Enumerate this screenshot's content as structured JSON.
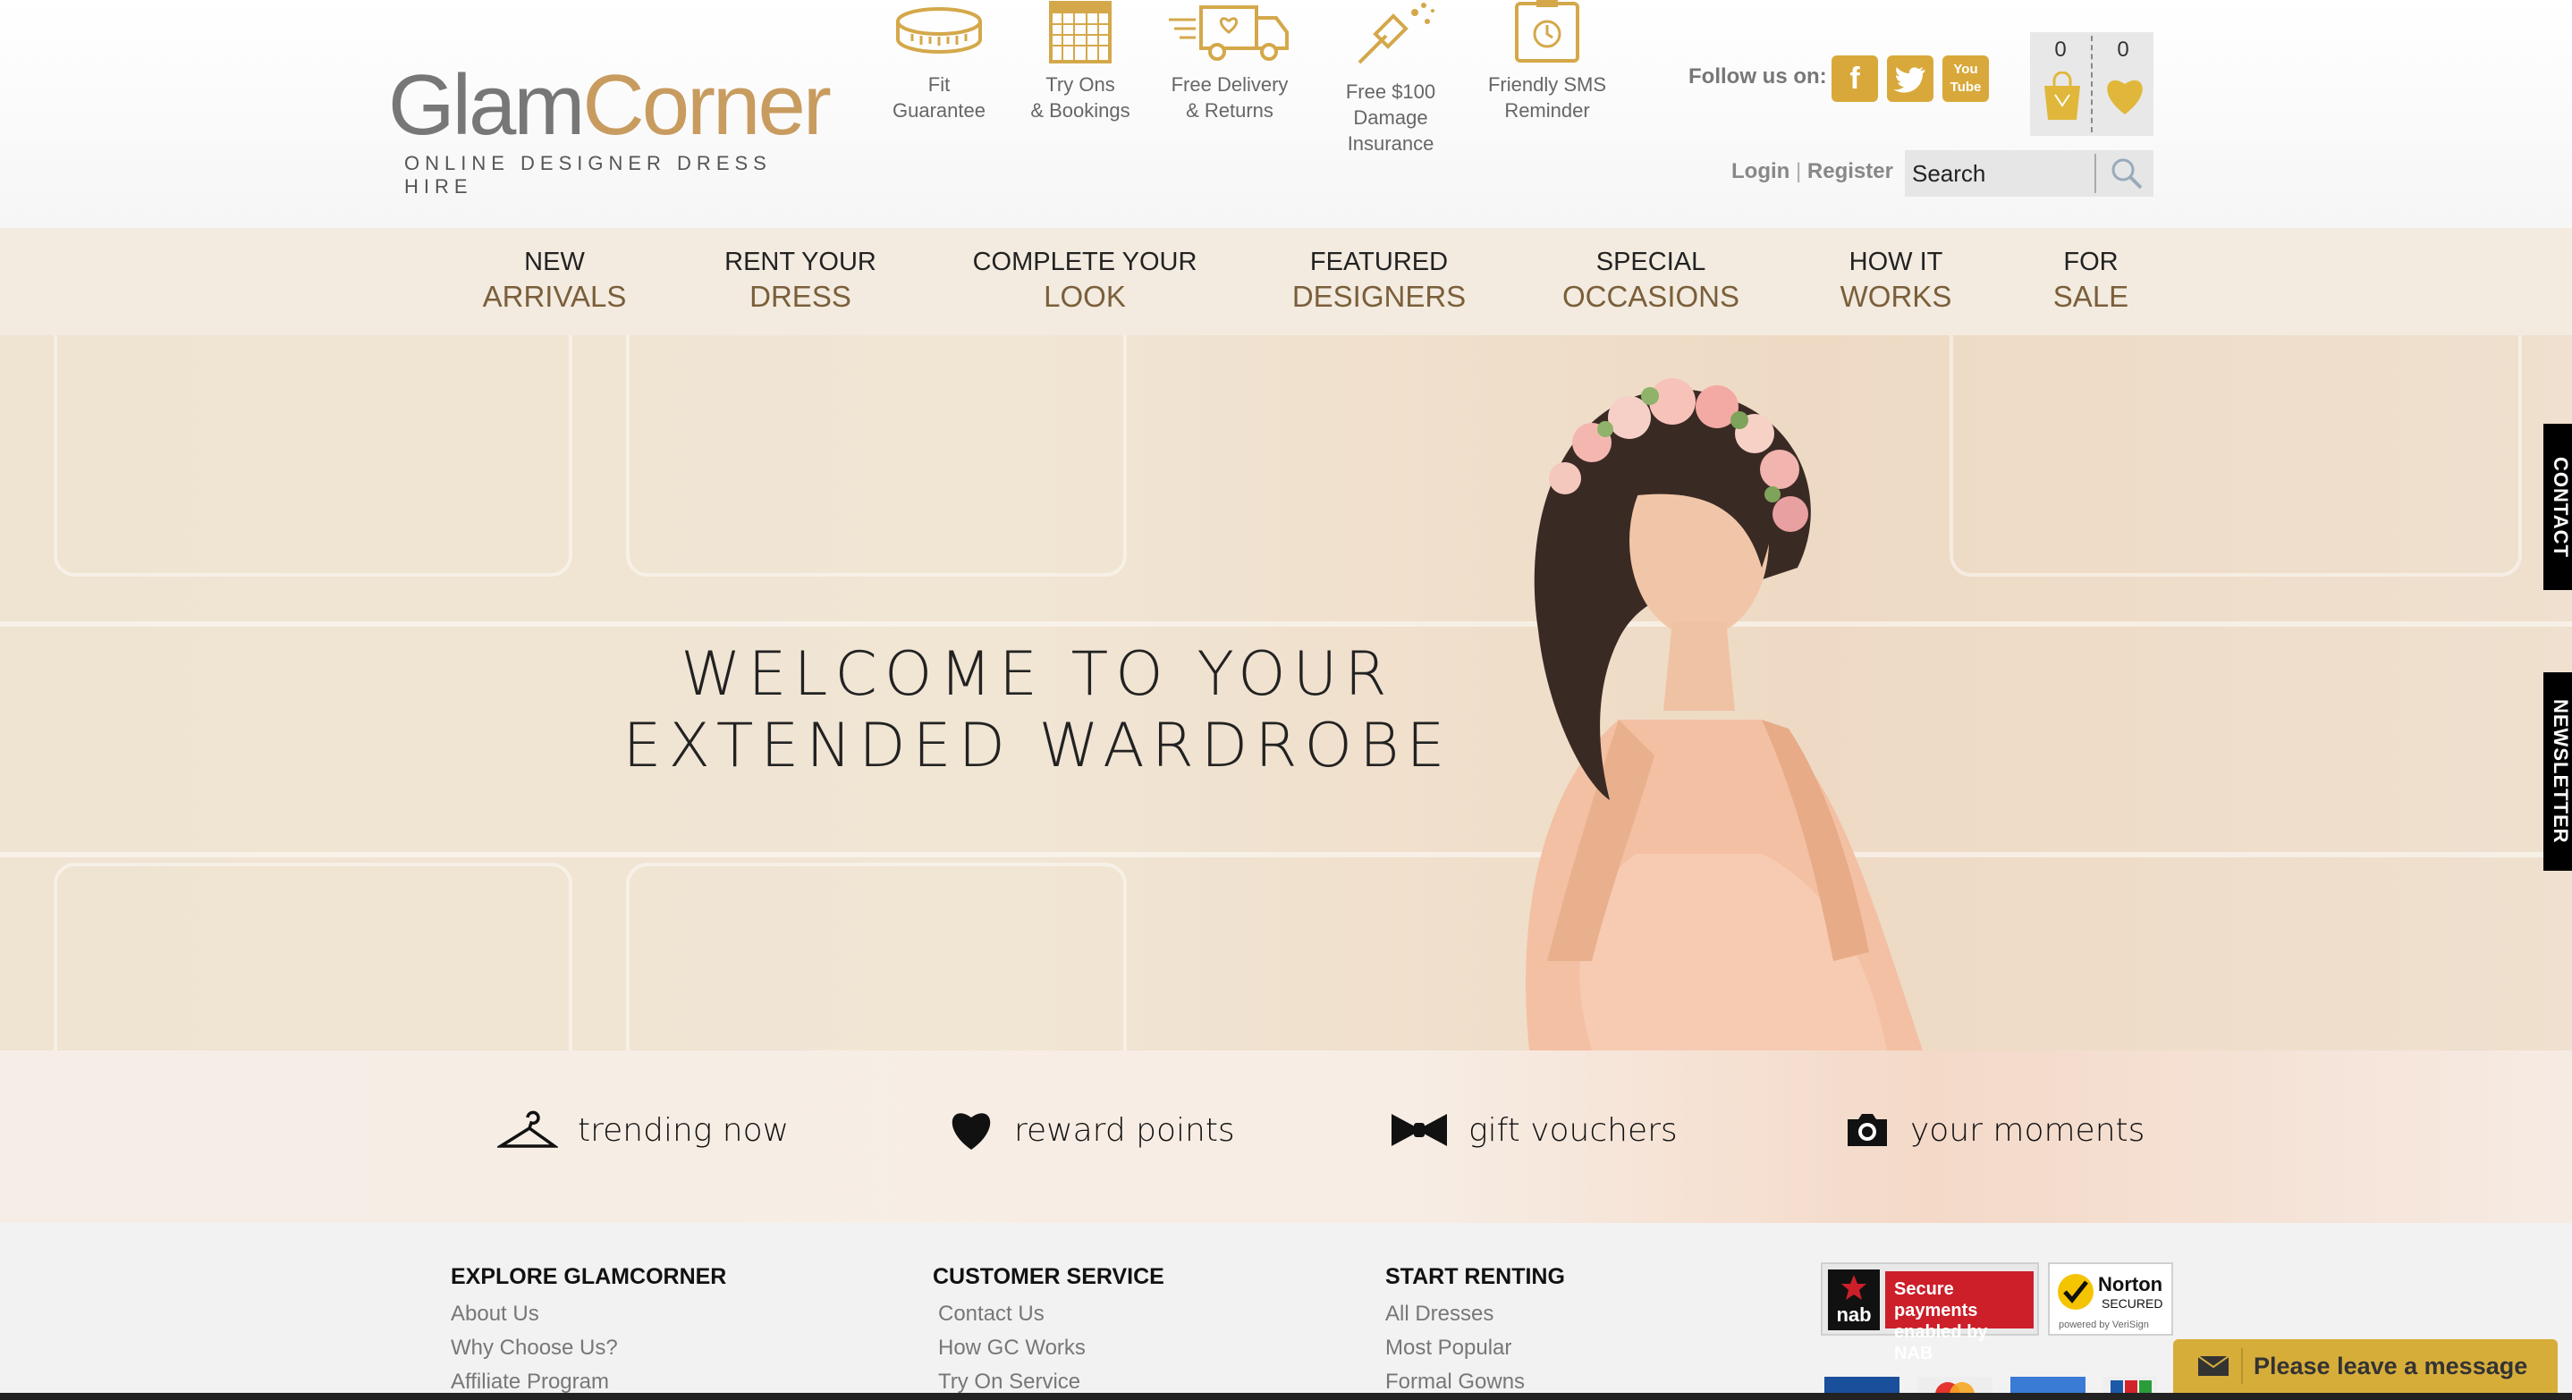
{
  "logo": {
    "glam": "Glam",
    "corner": "Corner",
    "tagline": "ONLINE DESIGNER DRESS HIRE"
  },
  "features": [
    {
      "icon": "tape-measure-icon",
      "line1": "Fit",
      "line2": "Guarantee"
    },
    {
      "icon": "calendar-icon",
      "line1": "Try Ons",
      "line2": "& Bookings"
    },
    {
      "icon": "delivery-truck-icon",
      "line1": "Free Delivery",
      "line2": "& Returns"
    },
    {
      "icon": "insurance-pin-icon",
      "line1": "Free $100",
      "line2": "Damage Insurance"
    },
    {
      "icon": "sms-phone-icon",
      "line1": "Friendly SMS",
      "line2": "Reminder"
    }
  ],
  "social": {
    "label": "Follow us on:",
    "facebook": "f",
    "youtube_1": "You",
    "youtube_2": "Tube"
  },
  "cart": {
    "bag_count": "0",
    "wishlist_count": "0"
  },
  "auth": {
    "login": "Login",
    "separator": "|",
    "register": "Register"
  },
  "search": {
    "placeholder": "Search"
  },
  "nav": [
    {
      "line1": "NEW",
      "line2": "ARRIVALS"
    },
    {
      "line1": "RENT YOUR",
      "line2": "DRESS"
    },
    {
      "line1": "COMPLETE YOUR",
      "line2": "LOOK"
    },
    {
      "line1": "FEATURED",
      "line2": "DESIGNERS"
    },
    {
      "line1": "SPECIAL",
      "line2": "OCCASIONS"
    },
    {
      "line1": "HOW IT",
      "line2": "WORKS"
    },
    {
      "line1": "FOR",
      "line2": "SALE"
    }
  ],
  "hero": {
    "line1": "WELCOME TO YOUR",
    "line2": "EXTENDED WARDROBE"
  },
  "quicklinks": [
    {
      "icon": "hanger-icon",
      "label": "trending now"
    },
    {
      "icon": "heart-icon",
      "label": "reward points"
    },
    {
      "icon": "bow-tie-icon",
      "label": "gift vouchers"
    },
    {
      "icon": "camera-icon",
      "label": "your moments"
    }
  ],
  "footer": {
    "explore": {
      "title": "EXPLORE GLAMCORNER",
      "links": [
        "About Us",
        "Why Choose Us?",
        "Affiliate Program"
      ]
    },
    "service": {
      "title": "CUSTOMER SERVICE",
      "links": [
        "Contact Us",
        "How GC Works",
        "Try On Service"
      ]
    },
    "renting": {
      "title": "START RENTING",
      "links": [
        "All Dresses",
        "Most Popular",
        "Formal Gowns"
      ]
    },
    "nab_mark": "nab",
    "nab_text": "Secure payments enabled by NAB",
    "norton_title": "Norton",
    "norton_sub": "SECURED",
    "norton_powered": "powered by VeriSign"
  },
  "sidetabs": {
    "contact": "CONTACT",
    "newsletter": "NEWSLETTER"
  },
  "chat": {
    "label": "Please leave a message"
  }
}
